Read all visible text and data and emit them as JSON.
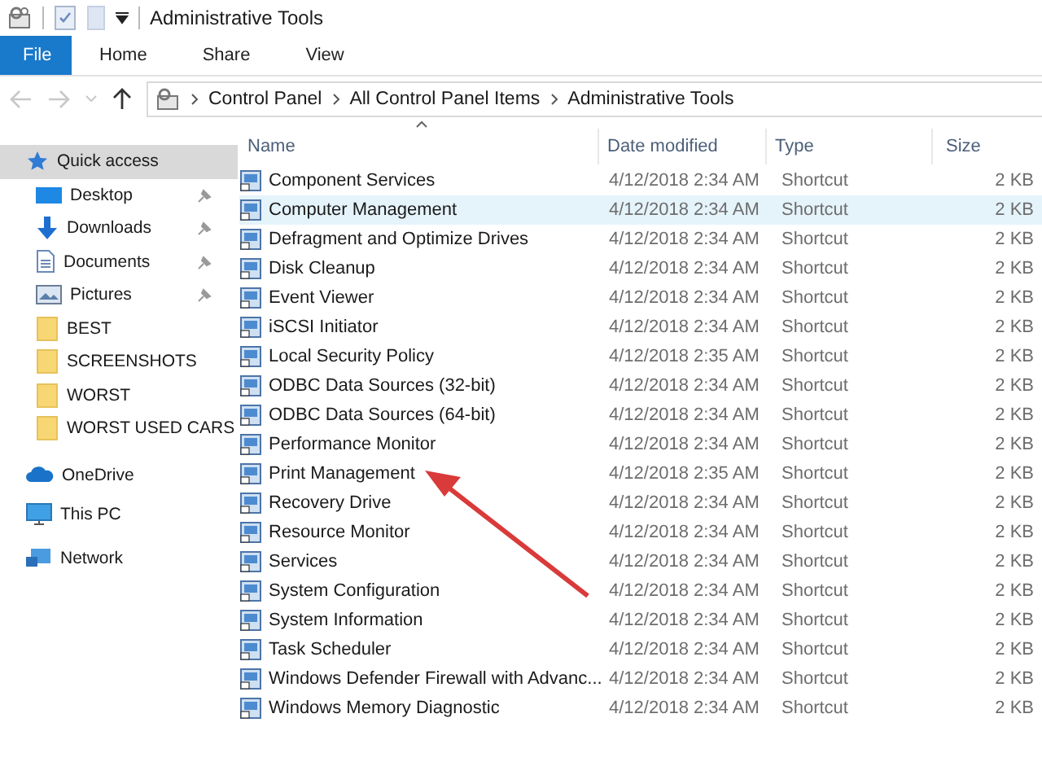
{
  "window": {
    "title": "Administrative Tools"
  },
  "ribbon_tabs": [
    {
      "label": "File",
      "selected": true
    },
    {
      "label": "Home",
      "selected": false
    },
    {
      "label": "Share",
      "selected": false
    },
    {
      "label": "View",
      "selected": false
    }
  ],
  "address_bar": {
    "path": [
      "Control Panel",
      "All Control Panel Items",
      "Administrative Tools"
    ]
  },
  "sidebar": {
    "items": [
      {
        "label": "Quick access",
        "kind": "star",
        "selected": true,
        "children": [
          {
            "label": "Desktop",
            "kind": "desktop",
            "selected": false,
            "pinned": true
          },
          {
            "label": "Downloads",
            "kind": "download",
            "selected": false,
            "pinned": true
          },
          {
            "label": "Documents",
            "kind": "document",
            "selected": false,
            "pinned": true
          },
          {
            "label": "Pictures",
            "kind": "pictures",
            "selected": false,
            "pinned": true
          },
          {
            "label": "BEST",
            "kind": "folder",
            "selected": false,
            "pinned": false
          },
          {
            "label": "SCREENSHOTS",
            "kind": "folder",
            "selected": false,
            "pinned": false
          },
          {
            "label": "WORST",
            "kind": "folder",
            "selected": false,
            "pinned": false
          },
          {
            "label": "WORST USED CARS",
            "kind": "folder",
            "selected": false,
            "pinned": false
          }
        ]
      },
      {
        "label": "OneDrive",
        "kind": "cloud",
        "selected": false
      },
      {
        "label": "This PC",
        "kind": "pc",
        "selected": false
      },
      {
        "label": "Network",
        "kind": "network",
        "selected": false
      }
    ]
  },
  "table": {
    "columns": [
      "Name",
      "Date modified",
      "Type",
      "Size"
    ],
    "rows": [
      {
        "name": "Component Services",
        "date": "4/12/2018 2:34 AM",
        "type": "Shortcut",
        "size": "2 KB",
        "selected": false
      },
      {
        "name": "Computer Management",
        "date": "4/12/2018 2:34 AM",
        "type": "Shortcut",
        "size": "2 KB",
        "selected": true
      },
      {
        "name": "Defragment and Optimize Drives",
        "date": "4/12/2018 2:34 AM",
        "type": "Shortcut",
        "size": "2 KB",
        "selected": false
      },
      {
        "name": "Disk Cleanup",
        "date": "4/12/2018 2:34 AM",
        "type": "Shortcut",
        "size": "2 KB",
        "selected": false
      },
      {
        "name": "Event Viewer",
        "date": "4/12/2018 2:34 AM",
        "type": "Shortcut",
        "size": "2 KB",
        "selected": false
      },
      {
        "name": "iSCSI Initiator",
        "date": "4/12/2018 2:34 AM",
        "type": "Shortcut",
        "size": "2 KB",
        "selected": false
      },
      {
        "name": "Local Security Policy",
        "date": "4/12/2018 2:35 AM",
        "type": "Shortcut",
        "size": "2 KB",
        "selected": false
      },
      {
        "name": "ODBC Data Sources (32-bit)",
        "date": "4/12/2018 2:34 AM",
        "type": "Shortcut",
        "size": "2 KB",
        "selected": false
      },
      {
        "name": "ODBC Data Sources (64-bit)",
        "date": "4/12/2018 2:34 AM",
        "type": "Shortcut",
        "size": "2 KB",
        "selected": false
      },
      {
        "name": "Performance Monitor",
        "date": "4/12/2018 2:34 AM",
        "type": "Shortcut",
        "size": "2 KB",
        "selected": false
      },
      {
        "name": "Print Management",
        "date": "4/12/2018 2:35 AM",
        "type": "Shortcut",
        "size": "2 KB",
        "selected": false
      },
      {
        "name": "Recovery Drive",
        "date": "4/12/2018 2:34 AM",
        "type": "Shortcut",
        "size": "2 KB",
        "selected": false
      },
      {
        "name": "Resource Monitor",
        "date": "4/12/2018 2:34 AM",
        "type": "Shortcut",
        "size": "2 KB",
        "selected": false
      },
      {
        "name": "Services",
        "date": "4/12/2018 2:34 AM",
        "type": "Shortcut",
        "size": "2 KB",
        "selected": false
      },
      {
        "name": "System Configuration",
        "date": "4/12/2018 2:34 AM",
        "type": "Shortcut",
        "size": "2 KB",
        "selected": false
      },
      {
        "name": "System Information",
        "date": "4/12/2018 2:34 AM",
        "type": "Shortcut",
        "size": "2 KB",
        "selected": false
      },
      {
        "name": "Task Scheduler",
        "date": "4/12/2018 2:34 AM",
        "type": "Shortcut",
        "size": "2 KB",
        "selected": false
      },
      {
        "name": "Windows Defender Firewall with Advanc...",
        "date": "4/12/2018 2:34 AM",
        "type": "Shortcut",
        "size": "2 KB",
        "selected": false
      },
      {
        "name": "Windows Memory Diagnostic",
        "date": "4/12/2018 2:34 AM",
        "type": "Shortcut",
        "size": "2 KB",
        "selected": false
      }
    ]
  }
}
